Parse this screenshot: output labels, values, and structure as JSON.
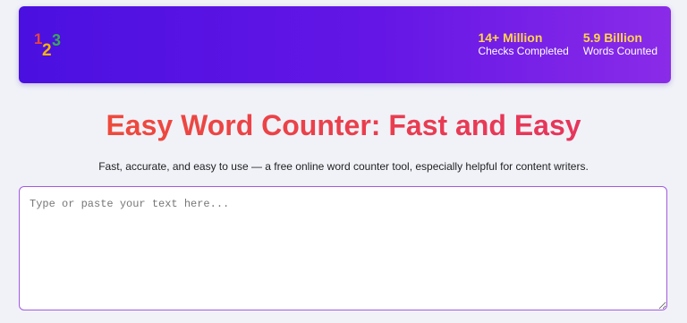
{
  "header": {
    "logo_text": "123",
    "stats": [
      {
        "value": "14+ Million",
        "label": "Checks Completed"
      },
      {
        "value": "5.9 Billion",
        "label": "Words Counted"
      }
    ]
  },
  "main": {
    "title": "Easy Word Counter: Fast and Easy",
    "subtitle": "Fast, accurate, and easy to use — a free online word counter tool, especially helpful for content writers."
  },
  "editor": {
    "value": "",
    "placeholder": "Type or paste your text here..."
  },
  "colors": {
    "header_start": "#4a10e0",
    "header_end": "#8a2be8",
    "stat_value": "#ffd54a",
    "title": "#e8454a",
    "editor_border": "#a35ae0"
  }
}
